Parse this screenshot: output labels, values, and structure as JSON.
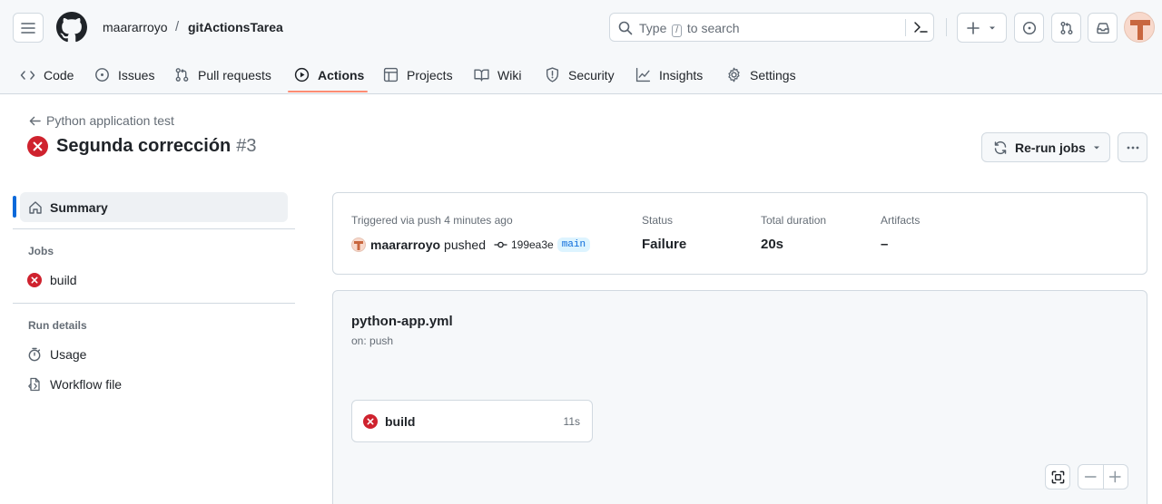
{
  "header": {
    "owner": "maararroyo",
    "separator": "/",
    "repo": "gitActionsTarea",
    "search": {
      "before": "Type ",
      "key": "/",
      "after": " to search"
    }
  },
  "tabs": [
    {
      "label": "Code",
      "icon": "code-icon"
    },
    {
      "label": "Issues",
      "icon": "issue-icon"
    },
    {
      "label": "Pull requests",
      "icon": "pull-request-icon"
    },
    {
      "label": "Actions",
      "icon": "play-icon",
      "active": true
    },
    {
      "label": "Projects",
      "icon": "table-icon"
    },
    {
      "label": "Wiki",
      "icon": "book-icon"
    },
    {
      "label": "Security",
      "icon": "shield-icon"
    },
    {
      "label": "Insights",
      "icon": "graph-icon"
    },
    {
      "label": "Settings",
      "icon": "gear-icon"
    }
  ],
  "run": {
    "back_label": "Python application test",
    "title": "Segunda corrección",
    "number": "#3",
    "rerun_label": "Re-run jobs"
  },
  "sidebar": {
    "summary": "Summary",
    "jobs_heading": "Jobs",
    "jobs": [
      {
        "label": "build",
        "status": "failure"
      }
    ],
    "run_details_heading": "Run details",
    "details": [
      {
        "label": "Usage",
        "icon": "stopwatch-icon"
      },
      {
        "label": "Workflow file",
        "icon": "file-code-icon"
      }
    ]
  },
  "summary": {
    "trigger": "Triggered via push 4 minutes ago",
    "user": "maararroyo",
    "verb": "pushed",
    "commit": "199ea3e",
    "branch": "main",
    "status_label": "Status",
    "status_value": "Failure",
    "duration_label": "Total duration",
    "duration_value": "20s",
    "artifacts_label": "Artifacts",
    "artifacts_value": "–"
  },
  "workflow": {
    "file": "python-app.yml",
    "on": "on: push",
    "job": {
      "name": "build",
      "duration": "11s"
    }
  },
  "colors": {
    "failure": "#cf222e",
    "accent_underline": "#fd8c73",
    "link_blue": "#0969da"
  }
}
